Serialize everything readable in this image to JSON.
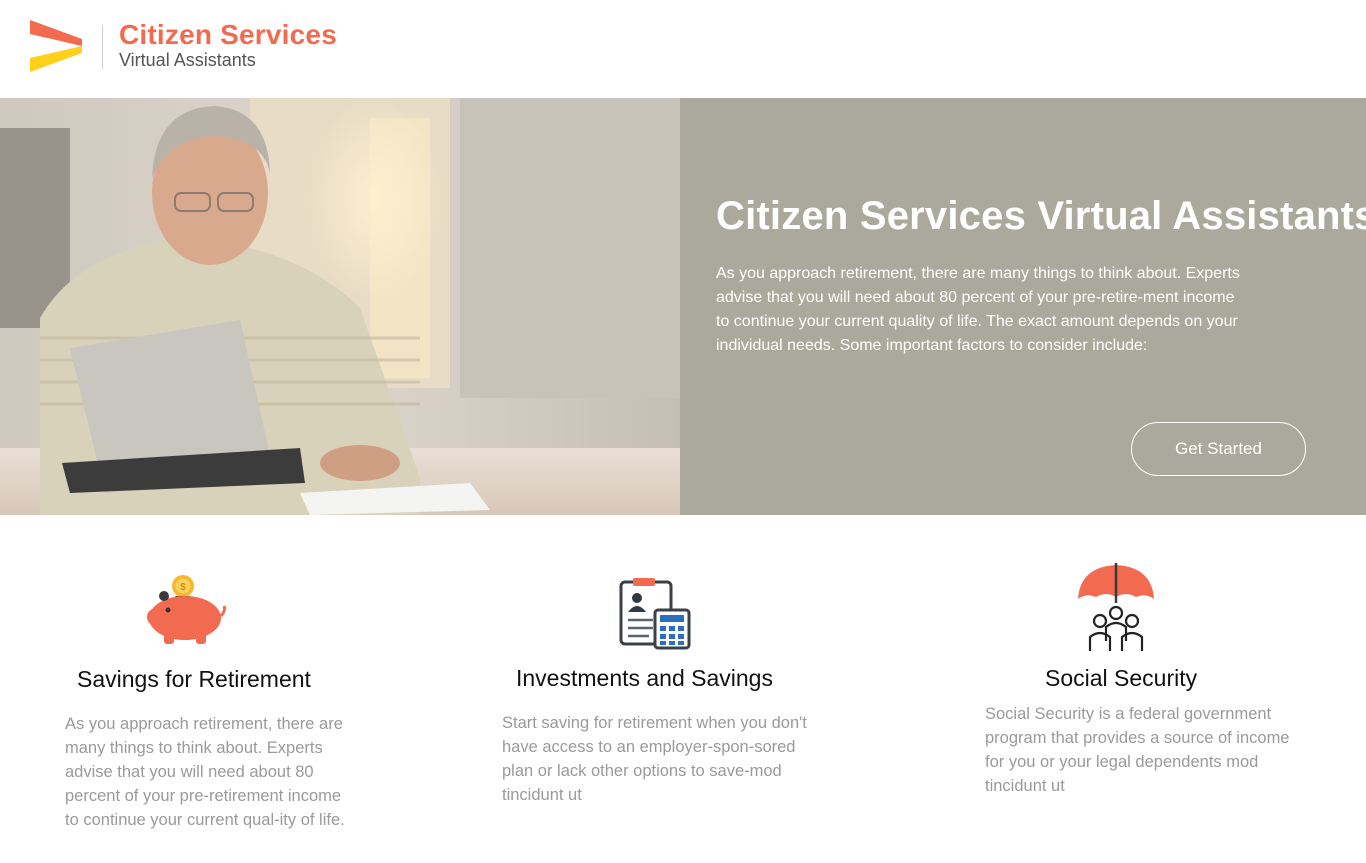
{
  "header": {
    "brand_title": "Citizen Services",
    "brand_subtitle": "Virtual Assistants",
    "logo_icon": "chevron-logo-icon"
  },
  "hero": {
    "image_alt": "Senior man using a laptop at a table",
    "title": "Citizen Services Virtual Assistants",
    "body": "As you approach retirement, there are many things to think about. Experts advise that you will need about 80 percent of your pre-retire-ment income to continue your current quality of life. The exact amount depends on your individual needs. Some important factors to consider include:",
    "button_label": "Get Started"
  },
  "features": [
    {
      "icon": "piggy-bank-icon",
      "title": "Savings for Retirement",
      "text": "As you approach retirement, there are many things to think about. Experts advise that you will need about 80 percent of your pre-retirement income to continue your current qual-ity of life."
    },
    {
      "icon": "clipboard-calculator-icon",
      "title": "Investments and Savings",
      "text": "Start saving for retirement when you don't have access to an employer-spon-sored plan or lack other options to save-mod tincidunt ut"
    },
    {
      "icon": "umbrella-family-icon",
      "title": "Social Security",
      "text": "Social Security is a federal government program that provides a source of income for you or your legal dependents mod tincidunt ut"
    }
  ],
  "colors": {
    "brand": "#f26b50",
    "hero_panel": "#aba99c",
    "muted_text": "#9a9a9a"
  }
}
